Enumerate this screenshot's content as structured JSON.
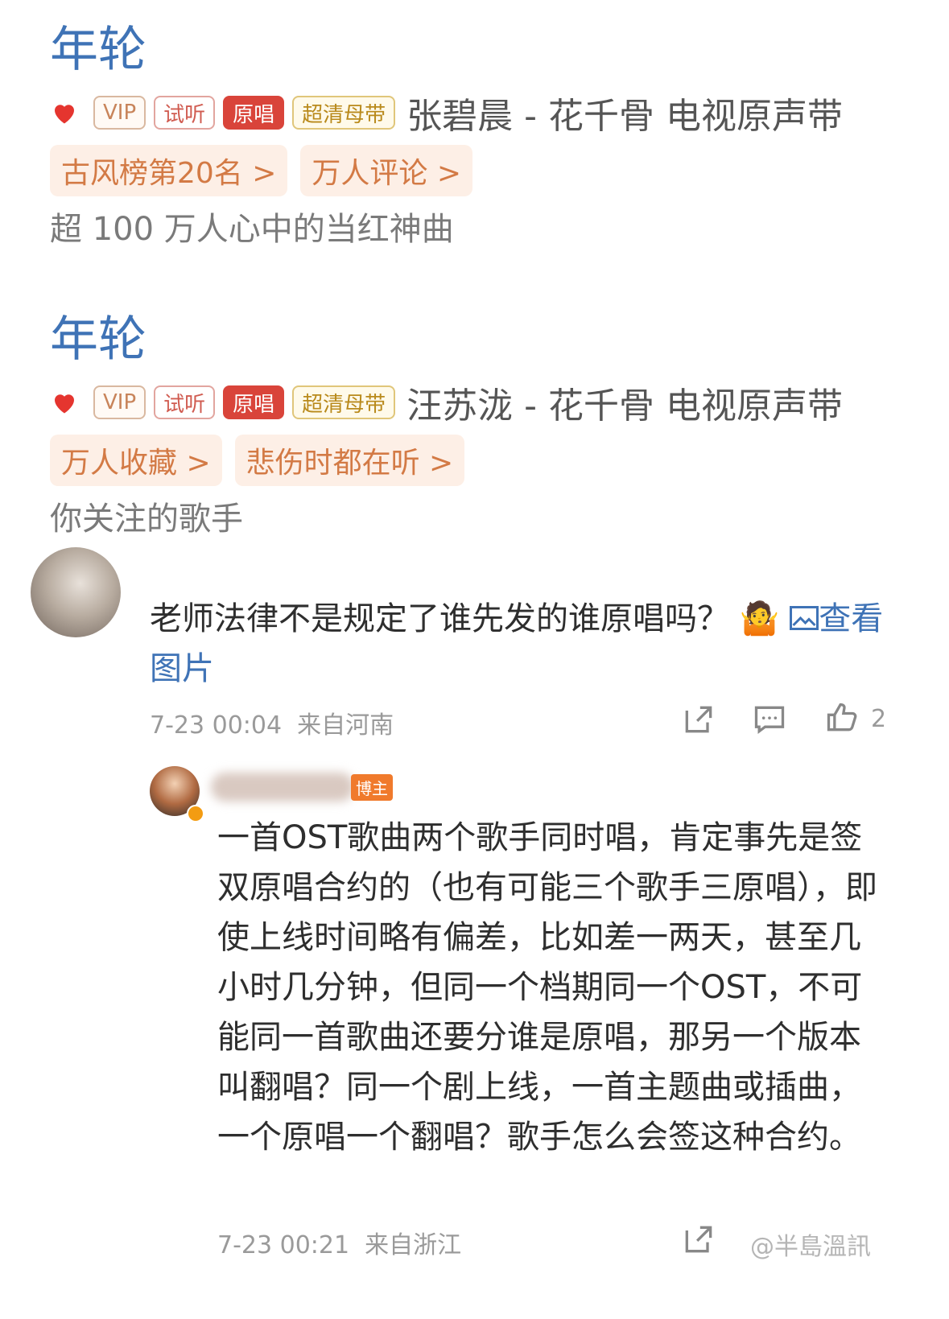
{
  "songs": [
    {
      "title": "年轮",
      "badges": {
        "vip": "VIP",
        "trial": "试听",
        "original": "原唱",
        "hq": "超清母带"
      },
      "artist_line": "张碧晨 - 花千骨 电视原声带",
      "tags": [
        "古风榜第20名 >",
        "万人评论 >"
      ],
      "subtitle": "超 100 万人心中的当红神曲"
    },
    {
      "title": "年轮",
      "badges": {
        "vip": "VIP",
        "trial": "试听",
        "original": "原唱",
        "hq": "超清母带"
      },
      "artist_line": "汪苏泷 - 花千骨 电视原声带",
      "tags": [
        "万人收藏 >",
        "悲伤时都在听 >"
      ],
      "subtitle": "你关注的歌手"
    }
  ],
  "comment": {
    "text": "老师法律不是规定了谁先发的谁原唱吗？",
    "emoji": "🤷",
    "view_image_link": "查看图片",
    "time": "7-23 00:04",
    "location": "来自河南",
    "like_count": "2"
  },
  "reply": {
    "author_badge": "博主",
    "text": "一首OST歌曲两个歌手同时唱，肯定事先是签双原唱合约的（也有可能三个歌手三原唱），即使上线时间略有偏差，比如差一两天，甚至几小时几分钟，但同一个档期同一个OST，不可能同一首歌曲还要分谁是原唱，那另一个版本叫翻唱？同一个剧上线，一首主题曲或插曲，一个原唱一个翻唱？歌手怎么会签这种合约。",
    "time": "7-23 00:21",
    "location": "来自浙江"
  },
  "watermark": "@半島溫訊"
}
